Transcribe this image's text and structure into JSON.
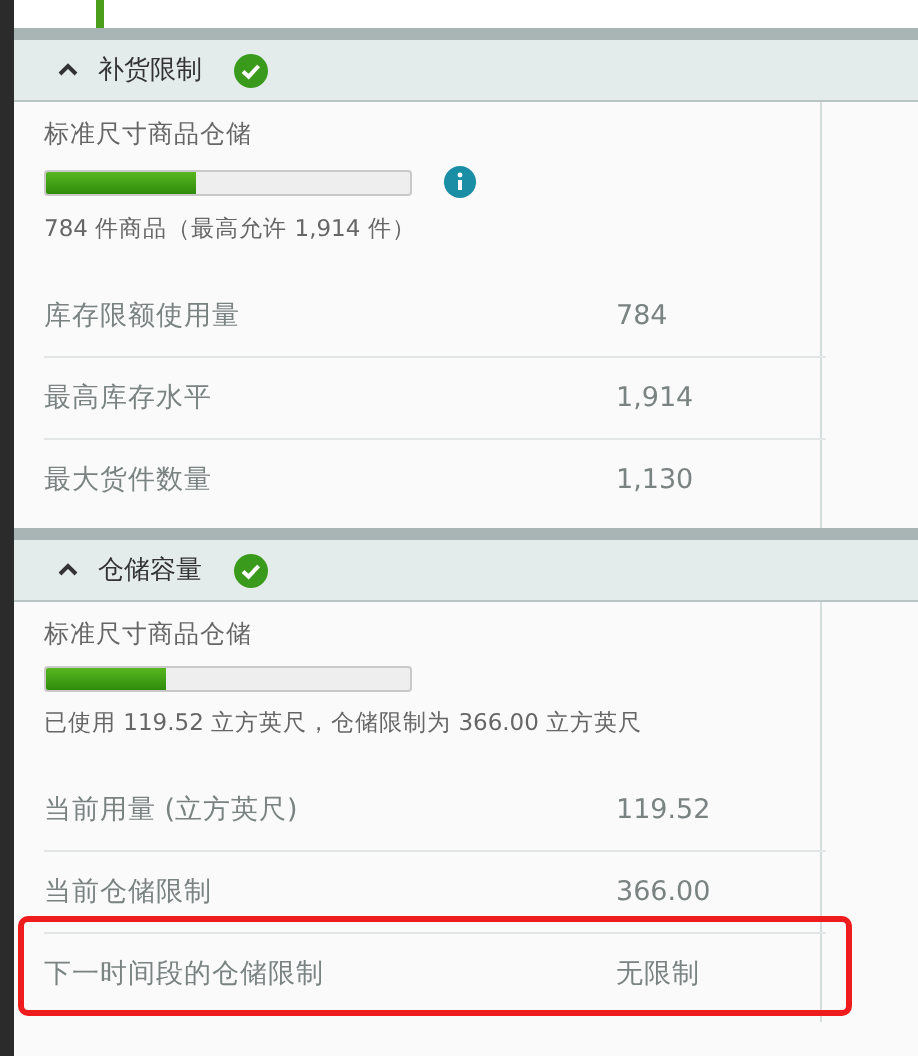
{
  "sections": [
    {
      "title": "补货限制",
      "expanded": true,
      "complete": true,
      "subtitle": "标准尺寸商品仓储",
      "level": 0.41,
      "info": true,
      "summary": "784 件商品（最高允许 1,914 件）",
      "rows": [
        {
          "label": "库存限额使用量",
          "value": "784",
          "highlighted": false
        },
        {
          "label": "最高库存水平",
          "value": "1,914",
          "highlighted": false
        },
        {
          "label": "最大货件数量",
          "value": "1,130",
          "highlighted": false
        }
      ]
    },
    {
      "title": "仓储容量",
      "expanded": true,
      "complete": true,
      "subtitle": "标准尺寸商品仓储",
      "level": 0.327,
      "info": false,
      "summary": "已使用 119.52 立方英尺，仓储限制为 366.00 立方英尺",
      "rows": [
        {
          "label": "当前用量 (立方英尺)",
          "value": "119.52",
          "highlighted": false
        },
        {
          "label": "当前仓储限制",
          "value": "366.00",
          "highlighted": false
        },
        {
          "label": "下一时间段的仓储限制",
          "value": "无限制",
          "highlighted": true
        }
      ]
    }
  ]
}
